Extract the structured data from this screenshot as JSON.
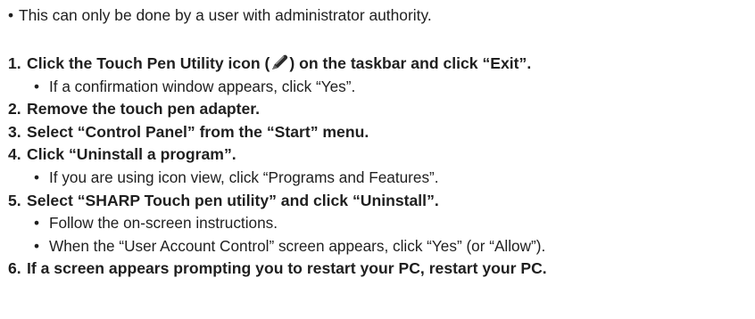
{
  "note": {
    "bullet": "•",
    "text": "This can only be done by a user with administrator authority."
  },
  "steps": [
    {
      "number": "1.",
      "text_before_icon": "Click the Touch Pen Utility icon (",
      "icon": "touch-pen-icon",
      "text_after_icon": ") on the taskbar and click “Exit”.",
      "subitems": [
        "If a confirmation window appears, click “Yes”."
      ]
    },
    {
      "number": "2.",
      "text": "Remove the touch pen adapter.",
      "subitems": []
    },
    {
      "number": "3.",
      "text": "Select “Control Panel” from the “Start” menu.",
      "subitems": []
    },
    {
      "number": "4.",
      "text": "Click “Uninstall a program”.",
      "subitems": [
        "If you are using icon view, click “Programs and Features”."
      ]
    },
    {
      "number": "5.",
      "text": "Select “SHARP Touch pen utility” and click “Uninstall”.",
      "subitems": [
        "Follow the on-screen instructions.",
        "When the “User Account Control” screen appears, click “Yes” (or “Allow”)."
      ]
    },
    {
      "number": "6.",
      "text": "If a screen appears prompting you to restart your PC, restart your PC.",
      "subitems": []
    }
  ],
  "sub_bullet": "•",
  "colors": {
    "text": "#1f1f1f",
    "pen_dark": "#2a2a2a",
    "pen_highlight": "#9a9a9a"
  }
}
